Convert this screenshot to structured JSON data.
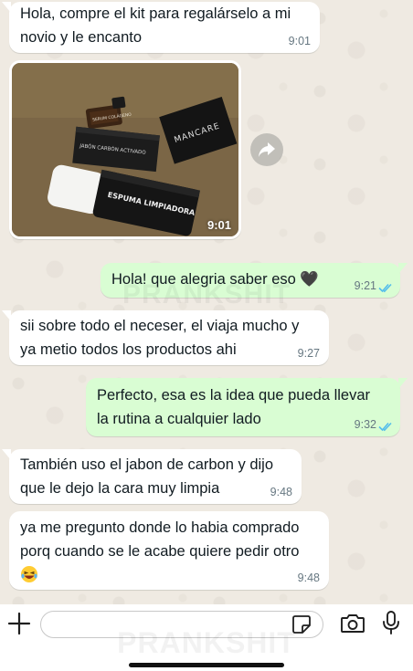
{
  "messages": [
    {
      "dir": "in",
      "lines": [
        "Hola, compre el kit para regalárselo a mi",
        "novio y le encanto"
      ],
      "time": "9:01"
    },
    {
      "dir": "in",
      "type": "image",
      "time": "9:01",
      "product_labels": [
        "MANCARE",
        "ESPUMA LIMPIADORA",
        "JABÓN CARBÓN ACTIVADO",
        "SERUM COLÁGENO"
      ]
    },
    {
      "dir": "out",
      "lines": [
        "Hola! que alegria saber eso 🖤"
      ],
      "time": "9:21"
    },
    {
      "dir": "in",
      "lines": [
        "sii sobre todo el neceser, el viaja mucho y",
        "ya metio todos los productos ahi"
      ],
      "time": "9:27"
    },
    {
      "dir": "out",
      "lines": [
        "Perfecto, esa es la idea que pueda llevar",
        "la rutina a cualquier lado"
      ],
      "time": "9:32"
    },
    {
      "dir": "in",
      "lines": [
        "También uso el jabon de carbon y dijo",
        "que le dejo la cara muy limpia"
      ],
      "time": "9:48"
    },
    {
      "dir": "in",
      "lines": [
        "ya me pregunto donde lo habia comprado",
        "porq cuando se le acabe quiere pedir otro"
      ],
      "time": "9:48"
    }
  ],
  "watermarks": [
    "PRANKSHIT",
    "PRANKSHIT"
  ],
  "icons": {
    "attach": "plus-icon",
    "forward": "forward-icon",
    "sticker": "sticker-icon",
    "camera": "camera-icon",
    "mic": "mic-icon",
    "read": "double-check-icon",
    "emoji": "laughing-emoji-icon"
  },
  "colors": {
    "chat_bg": "#efeae2",
    "incoming_bubble": "#ffffff",
    "outgoing_bubble": "#d9fdd3",
    "read_ticks": "#53bdeb",
    "timestamp": "#667781"
  }
}
